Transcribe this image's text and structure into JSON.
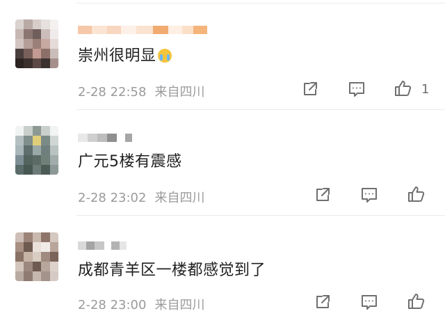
{
  "comments": [
    {
      "text": "崇州很明显",
      "emoji": "crying-face-icon",
      "timestamp": "2-28 22:58",
      "location": "来自四川",
      "like_count": "1"
    },
    {
      "text": "广元5楼有震感",
      "timestamp": "2-28 23:02",
      "location": "来自四川",
      "like_count": ""
    },
    {
      "text": "成都青羊区一楼都感觉到了",
      "timestamp": "2-28 23:00",
      "location": "来自四川",
      "like_count": ""
    }
  ],
  "icons": {
    "share": "share-icon",
    "comment": "comment-icon",
    "like": "thumbs-up-icon"
  },
  "colors": {
    "text": "#1f1f1f",
    "meta": "#9a9a9a",
    "icon": "#6f6f6f",
    "divider": "#ececec"
  }
}
